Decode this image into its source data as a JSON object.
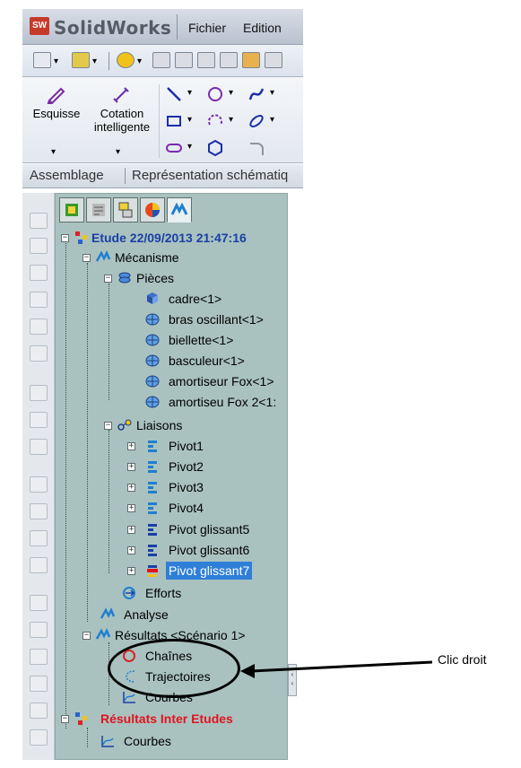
{
  "app": {
    "logo_text": "SolidWorks",
    "logo_badge": "SW",
    "menu": [
      "Fichier",
      "Edition"
    ]
  },
  "ribbon": {
    "sketch_label": "Esquisse",
    "smart_dim_label_1": "Cotation",
    "smart_dim_label_2": "intelligente"
  },
  "tabstrip": {
    "items": [
      "Assemblage",
      "Représentation schématiq"
    ]
  },
  "tree": {
    "study": "Etude 22/09/2013 21:47:16",
    "mechanism": "Mécanisme",
    "parts": "Pièces",
    "part_items": [
      "cadre<1>",
      "bras oscillant<1>",
      "biellette<1>",
      "basculeur<1>",
      "amortiseur Fox<1>",
      "amortiseu Fox 2<1:"
    ],
    "joints": "Liaisons",
    "joint_items": [
      "Pivot1",
      "Pivot2",
      "Pivot3",
      "Pivot4",
      "Pivot glissant5",
      "Pivot glissant6",
      "Pivot glissant7"
    ],
    "efforts": "Efforts",
    "analysis": "Analyse",
    "results": "Résultats <Scénario 1>",
    "results_items": [
      "Chaînes",
      "Trajectoires",
      "Courbes"
    ],
    "inter_results": "Résultats Inter Etudes",
    "inter_items": [
      "Courbes"
    ]
  },
  "annotation": {
    "label": "Clic droit"
  },
  "colors": {
    "panel_bg": "#a9c2bf",
    "selection": "#2f7fd8",
    "study_text": "#1b3fa6",
    "inter_text": "#e0141e"
  }
}
